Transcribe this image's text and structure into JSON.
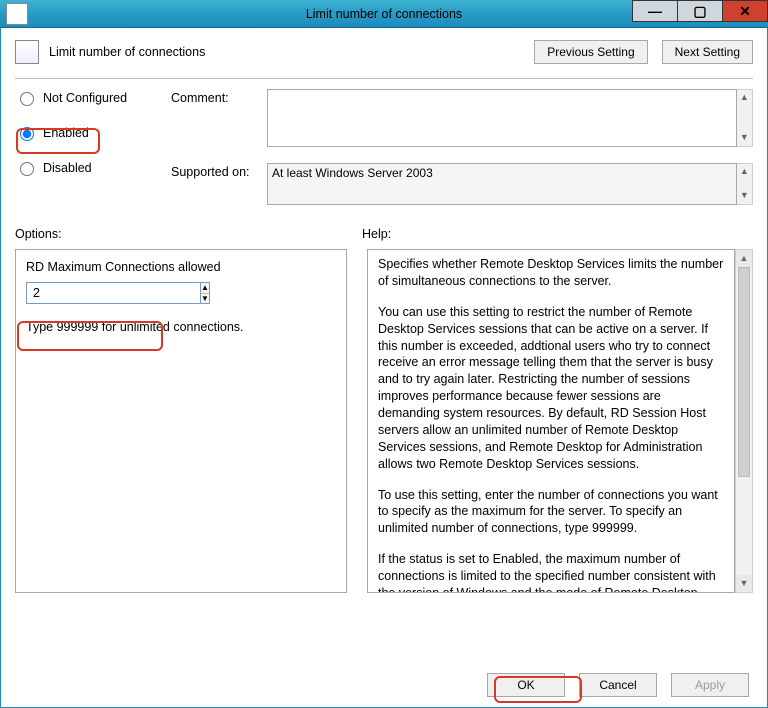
{
  "window": {
    "title": "Limit number of connections"
  },
  "header": {
    "policy_title": "Limit number of connections",
    "previous_label": "Previous Setting",
    "next_label": "Next Setting"
  },
  "state": {
    "not_configured_label": "Not Configured",
    "enabled_label": "Enabled",
    "disabled_label": "Disabled",
    "selected": "enabled"
  },
  "comment": {
    "label": "Comment:",
    "value": ""
  },
  "supported": {
    "label": "Supported on:",
    "value": "At least Windows Server 2003"
  },
  "labels": {
    "options": "Options:",
    "help": "Help:"
  },
  "options": {
    "rd_max_label": "RD Maximum Connections allowed",
    "rd_max_value": "2",
    "hint": "Type 999999 for unlimited connections."
  },
  "help": {
    "p1": "Specifies whether Remote Desktop Services limits the number of simultaneous connections to the server.",
    "p2": "You can use this setting to restrict the number of Remote Desktop Services sessions that can be active on a server. If this number is exceeded, addtional users who try to connect receive an error message telling them that the server is busy and to try again later. Restricting the number of sessions improves performance because fewer sessions are demanding system resources. By default, RD Session Host servers allow an unlimited number of Remote Desktop Services sessions, and Remote Desktop for Administration allows two Remote Desktop Services sessions.",
    "p3": "To use this setting, enter the number of connections you want to specify as the maximum for the server. To specify an unlimited number of connections, type 999999.",
    "p4": "If the status is set to Enabled, the maximum number of connections is limited to the specified number consistent with the version of Windows and the mode of Remote Desktop"
  },
  "buttons": {
    "ok": "OK",
    "cancel": "Cancel",
    "apply": "Apply"
  }
}
